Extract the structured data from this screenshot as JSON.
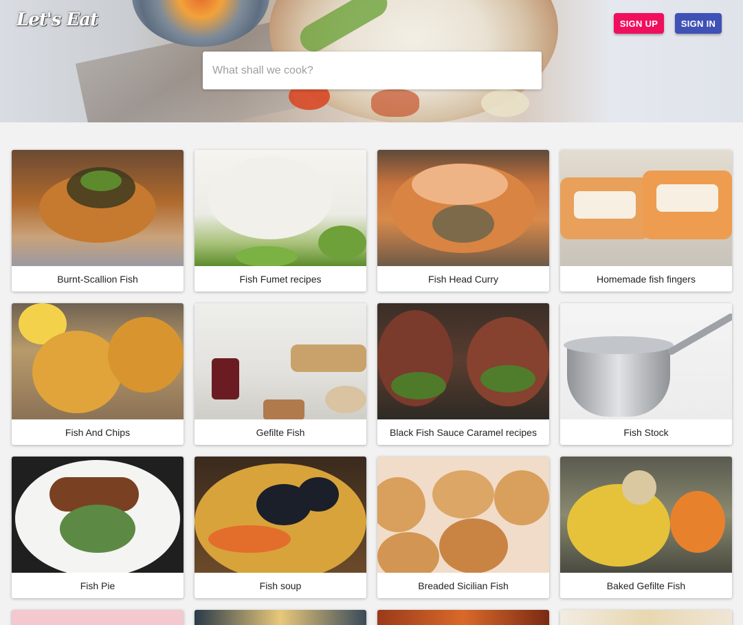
{
  "header": {
    "logo": "Let's Eat",
    "signup_label": "SIGN UP",
    "signin_label": "SIGN IN",
    "search_placeholder": "What shall we cook?",
    "search_value": ""
  },
  "colors": {
    "signup": "#f00f5d",
    "signin": "#3f51b5",
    "background": "#f2f2f3"
  },
  "recipes": [
    {
      "title": "Burnt-Scallion Fish"
    },
    {
      "title": "Fish Fumet recipes"
    },
    {
      "title": "Fish Head Curry"
    },
    {
      "title": "Homemade fish fingers"
    },
    {
      "title": "Fish And Chips"
    },
    {
      "title": "Gefilte Fish"
    },
    {
      "title": "Black Fish Sauce Caramel recipes"
    },
    {
      "title": "Fish Stock"
    },
    {
      "title": "Fish Pie"
    },
    {
      "title": "Fish soup"
    },
    {
      "title": "Breaded Sicilian Fish"
    },
    {
      "title": "Baked Gefilte Fish"
    }
  ]
}
